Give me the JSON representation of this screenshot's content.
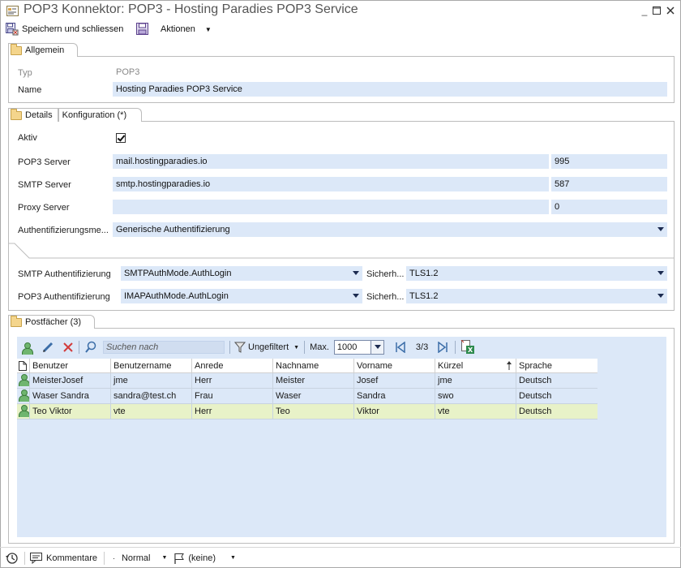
{
  "window": {
    "title": "POP3 Konnektor: POP3 - Hosting Paradies POP3 Service"
  },
  "toolbar": {
    "save_close_label": "Speichern und schliessen",
    "actions_label": "Aktionen"
  },
  "general": {
    "tab_label": "Allgemein",
    "type_label": "Typ",
    "type_value": "POP3",
    "name_label": "Name",
    "name_value": "Hosting Paradies POP3 Service"
  },
  "details": {
    "tabs": [
      {
        "label": "Details"
      },
      {
        "label": "Konfiguration (*)"
      }
    ],
    "active_label": "Aktiv",
    "active_checked": true,
    "pop3_server_label": "POP3 Server",
    "pop3_server_value": "mail.hostingparadies.io",
    "pop3_port": "995",
    "smtp_server_label": "SMTP Server",
    "smtp_server_value": "smtp.hostingparadies.io",
    "smtp_port": "587",
    "proxy_server_label": "Proxy Server",
    "proxy_server_value": "",
    "proxy_port": "0",
    "auth_method_label": "Authentifizierungsme...",
    "auth_method_value": "Generische Authentifizierung",
    "smtp_auth_label": "SMTP Authentifizierung",
    "smtp_auth_value": "SMTPAuthMode.AuthLogin",
    "smtp_security_label": "Sicherh...",
    "smtp_security_value": "TLS1.2",
    "pop3_auth_label": "POP3 Authentifizierung",
    "pop3_auth_value": "IMAPAuthMode.AuthLogin",
    "pop3_security_label": "Sicherh...",
    "pop3_security_value": "TLS1.2"
  },
  "mailboxes": {
    "tab_label": "Postfächer (3)",
    "search_placeholder": "Suchen nach",
    "filter_label": "Ungefiltert",
    "max_label": "Max.",
    "max_value": "1000",
    "page_indicator": "3/3",
    "columns": [
      "Benutzer",
      "Benutzername",
      "Anrede",
      "Nachname",
      "Vorname",
      "Kürzel",
      "Sprache"
    ],
    "rows": [
      {
        "user": "MeisterJosef",
        "username": "jme",
        "salutation": "Herr",
        "lastname": "Meister",
        "firstname": "Josef",
        "short": "jme",
        "language": "Deutsch"
      },
      {
        "user": "Waser Sandra",
        "username": "sandra@test.ch",
        "salutation": "Frau",
        "lastname": "Waser",
        "firstname": "Sandra",
        "short": "swo",
        "language": "Deutsch"
      },
      {
        "user": "Teo Viktor",
        "username": "vte",
        "salutation": "Herr",
        "lastname": "Teo",
        "firstname": "Viktor",
        "short": "vte",
        "language": "Deutsch"
      }
    ],
    "selected_row": 2
  },
  "statusbar": {
    "comments_label": "Kommentare",
    "priority_label": "Normal",
    "flag_label": "(keine)"
  },
  "colors": {
    "field_bg": "#dce8f8",
    "selected_row_bg": "#e8f2c8",
    "accent": "#1c2b50"
  },
  "icons": [
    "connector-icon",
    "save-close-icon",
    "save-icon",
    "folder-icon",
    "checkbox-icon",
    "person-icon",
    "pencil-icon",
    "delete-icon",
    "search-icon",
    "filter-icon",
    "first-page-icon",
    "last-page-icon",
    "excel-export-icon",
    "history-icon",
    "comment-icon",
    "flag-icon"
  ]
}
